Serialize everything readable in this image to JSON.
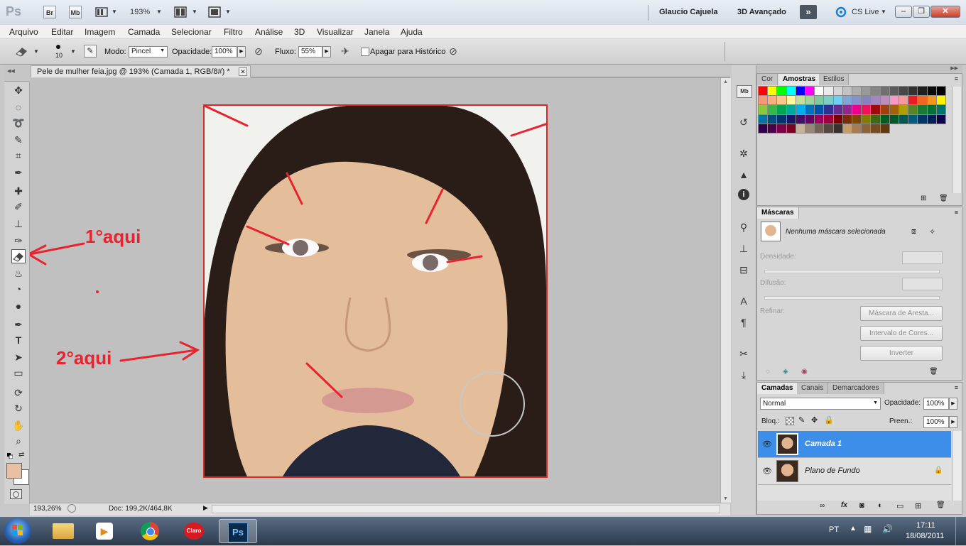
{
  "app": {
    "logo": "Ps",
    "br_button": "Br",
    "mb_button": "Mb",
    "zoom": "193%",
    "user": "Glaucio Cajuela",
    "workspace": "3D Avançado",
    "cs_live": "CS Live"
  },
  "menu": [
    "Arquivo",
    "Editar",
    "Imagem",
    "Camada",
    "Selecionar",
    "Filtro",
    "Análise",
    "3D",
    "Visualizar",
    "Janela",
    "Ajuda"
  ],
  "options": {
    "brush_size": "10",
    "mode_label": "Modo:",
    "mode_value": "Pincel",
    "opacity_label": "Opacidade:",
    "opacity_value": "100%",
    "flow_label": "Fluxo:",
    "flow_value": "55%",
    "history_label": "Apagar para Histórico"
  },
  "document": {
    "tab_title": "Pele de mulher feia.jpg @ 193% (Camada 1, RGB/8#) *",
    "status_zoom": "193,26%",
    "status_doc": "Doc: 199,2K/464,8K"
  },
  "annotations": {
    "first": "1°aqui",
    "second": "2°aqui"
  },
  "swatches_panel": {
    "tabs": [
      "Cor",
      "Amostras",
      "Estilos"
    ],
    "colors": [
      "#ff0000",
      "#ffff00",
      "#00ff00",
      "#00ffff",
      "#0000ff",
      "#ff00ff",
      "#ffffff",
      "#ebebeb",
      "#d6d6d6",
      "#c2c2c2",
      "#adadad",
      "#999999",
      "#858585",
      "#707070",
      "#5c5c5c",
      "#474747",
      "#333333",
      "#1f1f1f",
      "#0a0a0a",
      "#000000",
      "#f7977a",
      "#f9ad81",
      "#fdc68a",
      "#fff79a",
      "#c4df9b",
      "#a2d39c",
      "#82ca9d",
      "#7bcdc8",
      "#6ecff6",
      "#7ea7d8",
      "#8493ca",
      "#8882be",
      "#a187be",
      "#bc8dbf",
      "#f49ac2",
      "#f6989d",
      "#ed1c24",
      "#f26522",
      "#f7941d",
      "#fff200",
      "#8dc73f",
      "#39b54a",
      "#00a651",
      "#00a99d",
      "#00aeef",
      "#0072bc",
      "#0054a6",
      "#2e3192",
      "#662d91",
      "#92278f",
      "#ec008c",
      "#ed145b",
      "#9e0b0f",
      "#a0410d",
      "#a36209",
      "#aba000",
      "#598527",
      "#1a7b30",
      "#007236",
      "#00746b",
      "#0076a3",
      "#004b80",
      "#003471",
      "#1b1464",
      "#440e62",
      "#630460",
      "#9e005d",
      "#9e0039",
      "#790000",
      "#7b2e00",
      "#7d4900",
      "#827b00",
      "#406618",
      "#005e20",
      "#005826",
      "#005952",
      "#005b7f",
      "#003663",
      "#002157",
      "#0d004c",
      "#32004b",
      "#4b0049",
      "#7b0046",
      "#7a0026",
      "#c7b299",
      "#998675",
      "#736357",
      "#534741",
      "#37302d",
      "#c69c6d",
      "#a67c52",
      "#8c6239",
      "#754c24",
      "#603913"
    ]
  },
  "masks_panel": {
    "tab": "Máscaras",
    "status": "Nenhuma máscara selecionada",
    "density_label": "Densidade:",
    "feather_label": "Difusão:",
    "refine_label": "Refinar:",
    "btn_edge": "Máscara de Aresta...",
    "btn_range": "Intervalo de Cores...",
    "btn_invert": "Inverter"
  },
  "layers_panel": {
    "tabs": [
      "Camadas",
      "Canais",
      "Demarcadores"
    ],
    "blend_mode": "Normal",
    "opacity_label": "Opacidade:",
    "opacity_value": "100%",
    "lock_label": "Bloq.:",
    "fill_label": "Preen.:",
    "fill_value": "100%",
    "layers": [
      {
        "name": "Camada 1",
        "selected": true
      },
      {
        "name": "Plano de Fundo",
        "selected": false
      }
    ]
  },
  "taskbar": {
    "language": "PT",
    "time": "17:11",
    "date": "18/08/2011",
    "claro_label": "Claro",
    "ps_label": "Ps"
  },
  "colors": {
    "accent": "#3d8ee8",
    "annotation_red": "#e8232f",
    "foreground_swatch": "#e8c0a4",
    "background_swatch": "#ffffff"
  }
}
